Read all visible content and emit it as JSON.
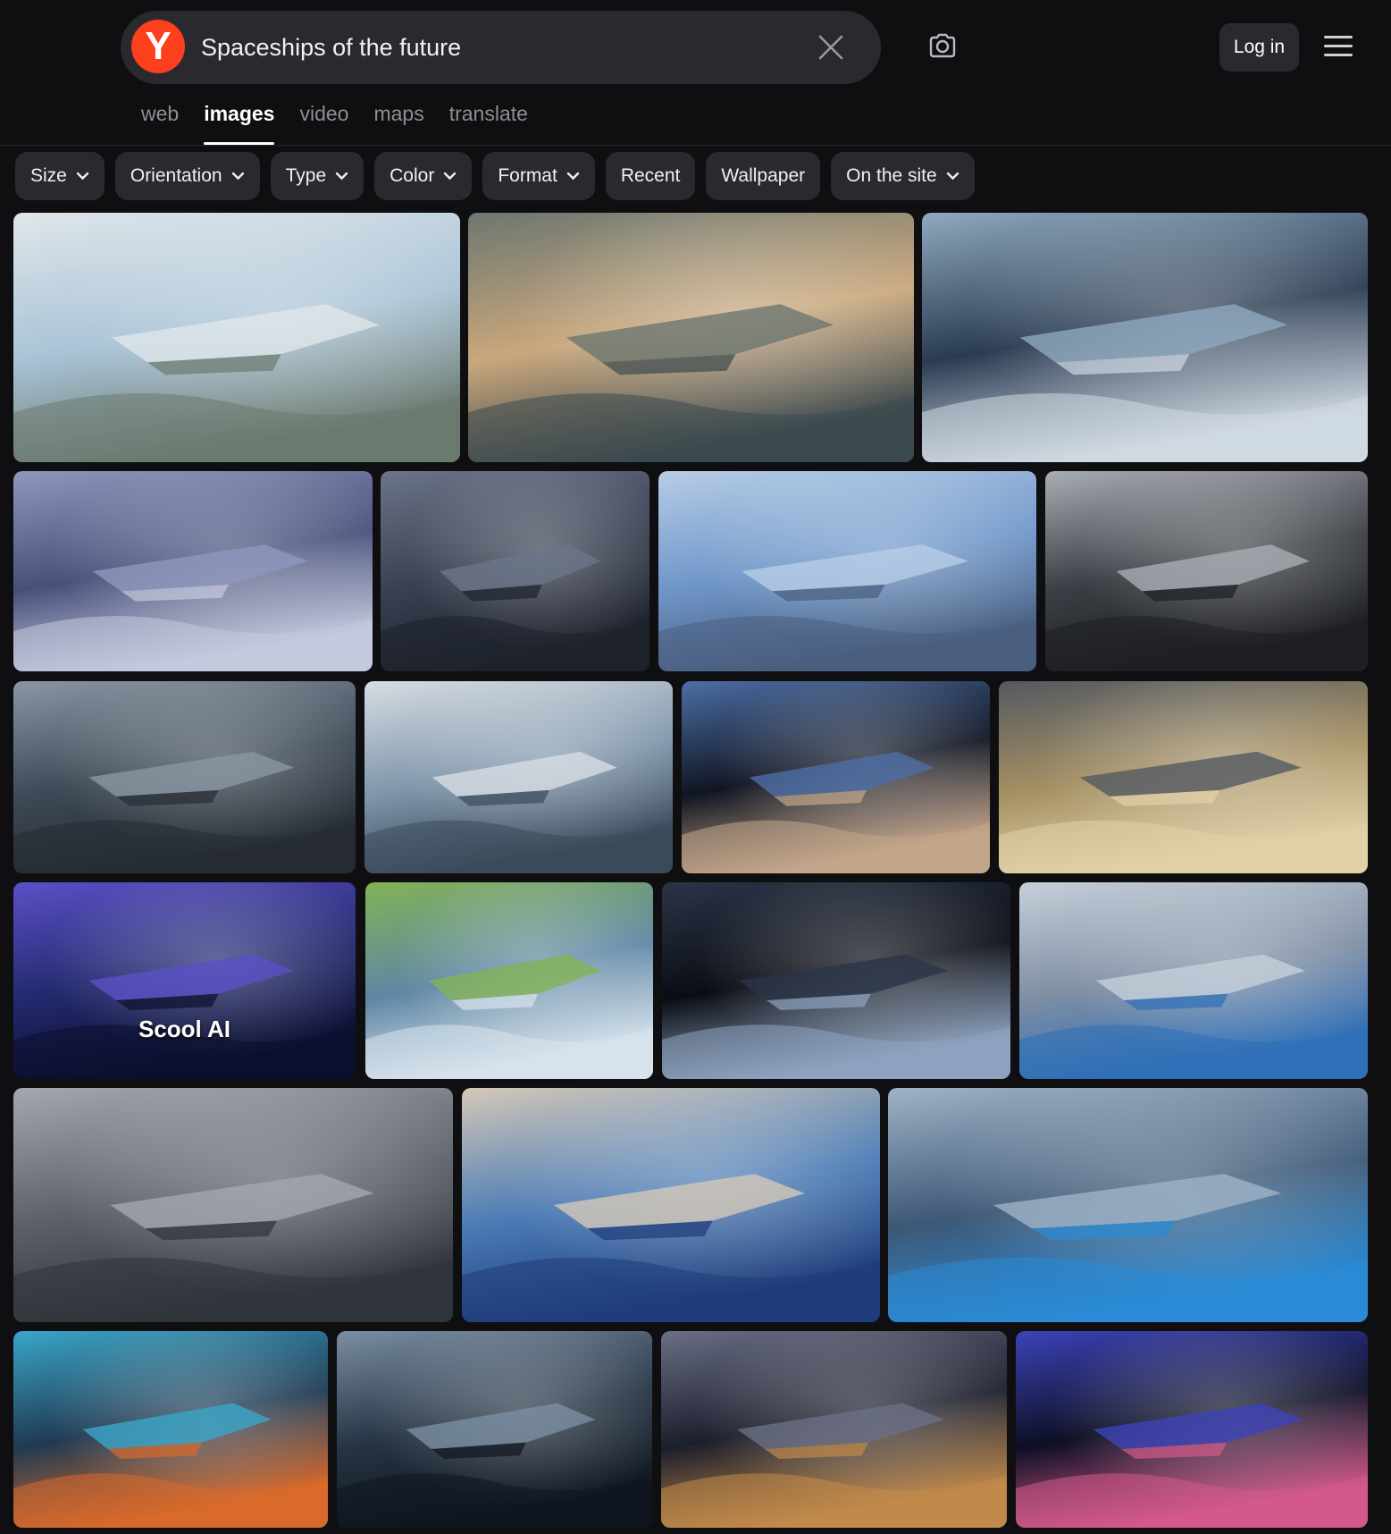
{
  "search": {
    "query": "Spaceships of the future",
    "logo_letter": "Y"
  },
  "header": {
    "login_label": "Log in"
  },
  "tabs": [
    "web",
    "images",
    "video",
    "maps",
    "translate"
  ],
  "active_tab": "images",
  "filters": [
    {
      "label": "Size",
      "has_dropdown": true
    },
    {
      "label": "Orientation",
      "has_dropdown": true
    },
    {
      "label": "Type",
      "has_dropdown": true
    },
    {
      "label": "Color",
      "has_dropdown": true
    },
    {
      "label": "Format",
      "has_dropdown": true
    },
    {
      "label": "Recent",
      "has_dropdown": false
    },
    {
      "label": "Wallpaper",
      "has_dropdown": false
    },
    {
      "label": "On the site",
      "has_dropdown": true
    }
  ],
  "colors": {
    "brand": "#fc3f1d",
    "background": "#0f0f11",
    "chip": "#2a2a2e"
  },
  "icons": [
    "close-icon",
    "camera-icon",
    "hamburger-menu-icon",
    "chevron-down-icon"
  ],
  "results": [
    {
      "palette": [
        "#a9c3d6",
        "#dfe6ea",
        "#6b7a70"
      ]
    },
    {
      "palette": [
        "#c9a77c",
        "#6d7770",
        "#3d4a4f"
      ]
    },
    {
      "palette": [
        "#2a3b52",
        "#8fa9bf",
        "#cfd9e2"
      ]
    },
    {
      "palette": [
        "#48507a",
        "#8f97bd",
        "#c4c9de"
      ]
    },
    {
      "palette": [
        "#3a4152",
        "#6c7588",
        "#1e232c"
      ]
    },
    {
      "palette": [
        "#6f96c9",
        "#b7cde6",
        "#4a5e7f"
      ]
    },
    {
      "palette": [
        "#3c3f45",
        "#a9adb4",
        "#1d1f23"
      ]
    },
    {
      "palette": [
        "#3e4a57",
        "#8997a4",
        "#262c33"
      ]
    },
    {
      "palette": [
        "#7f96ab",
        "#d7dde3",
        "#3a4a5a"
      ]
    },
    {
      "palette": [
        "#101522",
        "#4d6ea6",
        "#c3a58a"
      ]
    },
    {
      "palette": [
        "#a59063",
        "#545961",
        "#e2d1a8"
      ]
    },
    {
      "palette": [
        "#232a6e",
        "#5b50c7",
        "#0c0f2e"
      ],
      "overlay_text": "Scool AI"
    },
    {
      "palette": [
        "#5f86a4",
        "#82b355",
        "#d7e3ec"
      ]
    },
    {
      "palette": [
        "#0a0d14",
        "#2b3548",
        "#8ea2bf"
      ]
    },
    {
      "palette": [
        "#7f8ea3",
        "#c6d0da",
        "#2e6fb8"
      ]
    },
    {
      "palette": [
        "#5b6068",
        "#a3a8ae",
        "#30343a"
      ]
    },
    {
      "palette": [
        "#4a7bb5",
        "#d4c8b8",
        "#1f3c7a"
      ]
    },
    {
      "palette": [
        "#3d5876",
        "#9fb3c7",
        "#2a8bd6"
      ]
    },
    {
      "palette": [
        "#1f3a52",
        "#3aa6c9",
        "#d96a2b"
      ]
    },
    {
      "palette": [
        "#263444",
        "#7b8fa3",
        "#0f161f"
      ]
    },
    {
      "palette": [
        "#1b1e2c",
        "#6a6f85",
        "#c28a4a"
      ]
    },
    {
      "palette": [
        "#0d0f24",
        "#3c43b8",
        "#d45a8a"
      ]
    }
  ]
}
